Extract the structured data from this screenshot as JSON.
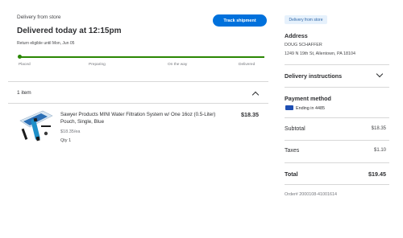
{
  "shipment": {
    "fulfillment": "Delivery from store",
    "status_title": "Delivered today at 12:15pm",
    "return_note": "Return eligible until Mon, Jun 05",
    "track_label": "Track shipment",
    "steps": [
      "Placed",
      "Preparing",
      "On the way",
      "Delivered"
    ],
    "progress": 1.0,
    "progress_color": "#2a8703"
  },
  "items": {
    "header": "1 item",
    "product": {
      "name": "Sawyer Products MINI Water Filtration System w/ One 16oz (0.5-Liter) Pouch, Single, Blue",
      "unit_price": "$18.35/ea",
      "qty": "Qty 1",
      "price": "$18.35"
    }
  },
  "summary": {
    "badge": "Delivery from store",
    "address_title": "Address",
    "address_name": "DOUG SCHAFFER",
    "address_street": "1249 N 19th St, Allentown, PA 18104",
    "delivery_instructions": "Delivery instructions",
    "payment_title": "Payment method",
    "card_text": "Ending in 4485",
    "subtotal_label": "Subtotal",
    "subtotal_value": "$18.35",
    "taxes_label": "Taxes",
    "taxes_value": "$1.10",
    "total_label": "Total",
    "total_value": "$19.45",
    "order_number": "Order# 2000108-41001614"
  },
  "colors": {
    "accent": "#0071dc",
    "success": "#2a8703",
    "badge_bg": "#e6f1fc"
  }
}
